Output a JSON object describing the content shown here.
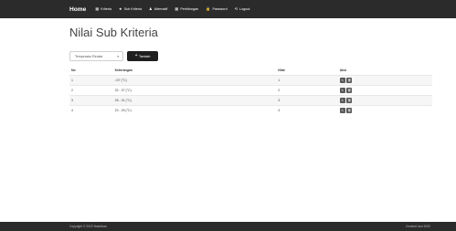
{
  "navbar": {
    "brand": "Home",
    "items": [
      {
        "icon": "grid-icon",
        "glyph": "▦",
        "label": "Kriteria"
      },
      {
        "icon": "star-icon",
        "glyph": "★",
        "label": "Sub Kriteria"
      },
      {
        "icon": "user-icon",
        "glyph": "♟",
        "label": "Alternatif"
      },
      {
        "icon": "table-icon",
        "glyph": "▦",
        "label": "Perhitungan"
      },
      {
        "icon": "lock-icon",
        "glyph": "🔒",
        "label": "Password"
      },
      {
        "icon": "logout-icon",
        "glyph": "⟲",
        "label": "Logout"
      }
    ]
  },
  "page": {
    "title": "Nilai Sub Kriteria"
  },
  "toolbar": {
    "selected_option": "Temperatur Rerata",
    "add_label": "Tambah"
  },
  "table": {
    "headers": [
      "No",
      "Keterangan",
      "Nilai",
      "Aksi"
    ],
    "rows": [
      {
        "no": "1",
        "keterangan": ">37 (°C)",
        "nilai": "1"
      },
      {
        "no": "2",
        "keterangan": "32 - 37 (°C)",
        "nilai": "2"
      },
      {
        "no": "3",
        "keterangan": "26 - 31 (°C)",
        "nilai": "3"
      },
      {
        "no": "4",
        "keterangan": "20 - 25 (°C)",
        "nilai": "4"
      }
    ]
  },
  "footer": {
    "left": "Copyright © 2022 Nasrkhan",
    "right": "Created Juni 2022"
  },
  "colors": {
    "navbar_bg": "#2b2b2b",
    "footer_bg": "#2b2b2b",
    "button_dark": "#1f1f1f",
    "row_stripe": "#f6f6f6"
  }
}
